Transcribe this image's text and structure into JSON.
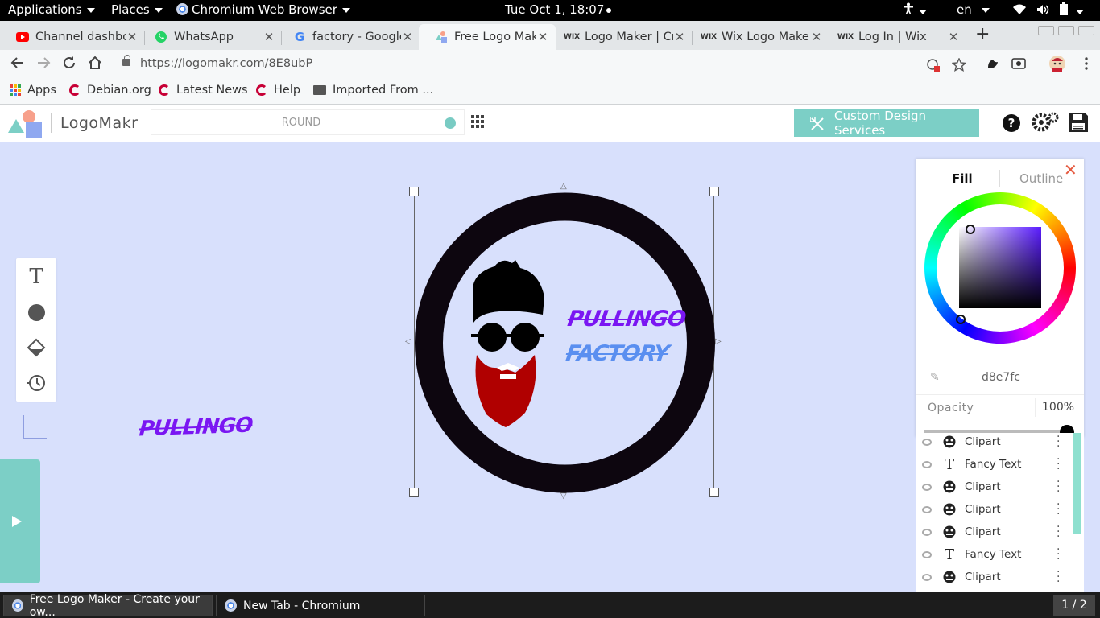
{
  "topbar": {
    "applications": "Applications",
    "places": "Places",
    "browser": "Chromium Web Browser",
    "datetime": "Tue Oct  1, 18:07",
    "language": "en"
  },
  "tabs": [
    {
      "title": "Channel dashboa",
      "favicon": "youtube-icon",
      "active": false
    },
    {
      "title": "WhatsApp",
      "favicon": "whatsapp-icon",
      "active": false
    },
    {
      "title": "factory - Google",
      "favicon": "google-icon",
      "active": false
    },
    {
      "title": "Free Logo Make",
      "favicon": "logomakr-icon",
      "active": true
    },
    {
      "title": "Logo Maker | Cr",
      "favicon": "wix-icon",
      "active": false
    },
    {
      "title": "Wix Logo Maker",
      "favicon": "wix-icon",
      "active": false
    },
    {
      "title": "Log In | Wix",
      "favicon": "wix-icon",
      "active": false
    }
  ],
  "toolbar": {
    "url": "https://logomakr.com/8E8ubP"
  },
  "bookmarks": [
    {
      "label": "Apps",
      "icon": "apps-grid-icon"
    },
    {
      "label": "Debian.org",
      "icon": "debian-icon"
    },
    {
      "label": "Latest News",
      "icon": "debian-icon"
    },
    {
      "label": "Help",
      "icon": "debian-icon"
    },
    {
      "label": "Imported From ...",
      "icon": "folder-icon"
    }
  ],
  "logomakr": {
    "brand": "LogoMakr",
    "search_placeholder": "ROUND",
    "custom_design_label": "Custom Design Services",
    "accent": "#7ccfc6"
  },
  "canvas": {
    "floating_text": "PULLINGO",
    "logo_line1": "PULLINGO",
    "logo_line2": "FACTORY",
    "logo_line1_color": "#7a16f2",
    "logo_line2_color": "#5a8ff0",
    "ring_color": "#0d060f",
    "beard_color": "#b00000",
    "background": "#d8e0fc"
  },
  "colorpanel": {
    "tab_fill": "Fill",
    "tab_outline": "Outline",
    "hex": "d8e7fc",
    "opacity_label": "Opacity",
    "opacity_value": "100%"
  },
  "layers": [
    {
      "label": "Clipart",
      "kind": "clipart-icon"
    },
    {
      "label": "Fancy Text",
      "kind": "text-icon"
    },
    {
      "label": "Clipart",
      "kind": "clipart-icon"
    },
    {
      "label": "Clipart",
      "kind": "clipart-icon"
    },
    {
      "label": "Clipart",
      "kind": "clipart-icon"
    },
    {
      "label": "Fancy Text",
      "kind": "text-icon"
    },
    {
      "label": "Clipart",
      "kind": "clipart-icon"
    }
  ],
  "taskbar": {
    "task1": "Free Logo Maker - Create your ow...",
    "task2": "New Tab - Chromium",
    "pager": "1 / 2"
  }
}
